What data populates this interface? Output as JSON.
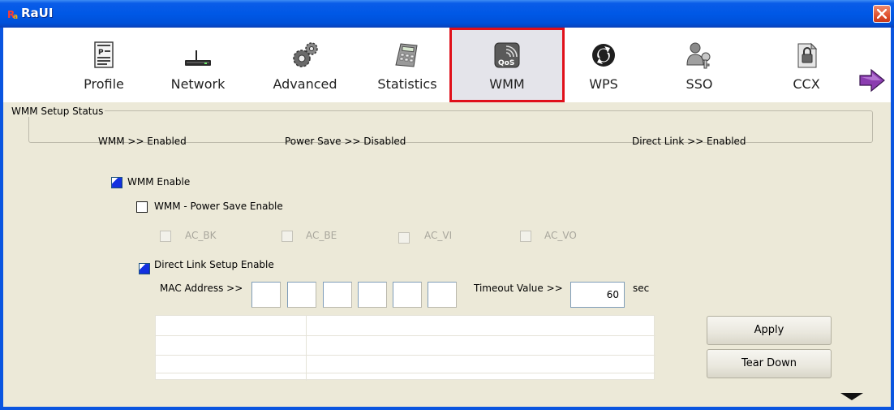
{
  "window": {
    "title": "RaUI"
  },
  "toolbar": {
    "items": [
      {
        "label": "Profile",
        "icon": "profile-icon"
      },
      {
        "label": "Network",
        "icon": "network-icon"
      },
      {
        "label": "Advanced",
        "icon": "advanced-icon"
      },
      {
        "label": "Statistics",
        "icon": "statistics-icon"
      },
      {
        "label": "WMM",
        "icon": "qos-icon",
        "icon_text": "QoS",
        "selected": true
      },
      {
        "label": "WPS",
        "icon": "wps-icon"
      },
      {
        "label": "SSO",
        "icon": "sso-icon"
      },
      {
        "label": "CCX",
        "icon": "ccx-icon"
      }
    ],
    "next_icon": "right-arrow-icon"
  },
  "status": {
    "legend": "WMM Setup Status",
    "wmm": "WMM >> Enabled",
    "power_save": "Power Save >> Disabled",
    "direct_link": "Direct Link >> Enabled"
  },
  "options": {
    "wmm_enable": {
      "label": "WMM Enable",
      "checked": true
    },
    "power_save_enable": {
      "label": "WMM - Power Save Enable",
      "checked": false
    },
    "ac": [
      {
        "label": "AC_BK",
        "checked": false,
        "enabled": false
      },
      {
        "label": "AC_BE",
        "checked": false,
        "enabled": false
      },
      {
        "label": "AC_VI",
        "checked": false,
        "enabled": false
      },
      {
        "label": "AC_VO",
        "checked": false,
        "enabled": false
      }
    ],
    "direct_link_enable": {
      "label": "Direct Link Setup Enable",
      "checked": true
    }
  },
  "dls": {
    "mac_label": "MAC Address >>",
    "mac_octets": [
      "",
      "",
      "",
      "",
      "",
      ""
    ],
    "timeout_label": "Timeout Value >>",
    "timeout_value": "60",
    "timeout_unit": "sec",
    "apply_label": "Apply",
    "teardown_label": "Tear Down"
  },
  "colors": {
    "title_bar": "#0058E6",
    "selected_border": "#E0101A",
    "checked": "#1230E0"
  }
}
